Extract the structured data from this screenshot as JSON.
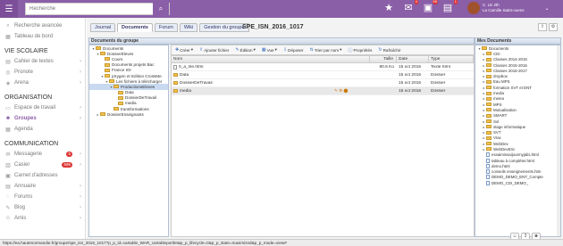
{
  "header": {
    "search_placeholder": "Recherche",
    "notifications": {
      "mail_count": "4",
      "messages_count": "99",
      "other_count": "1"
    },
    "user": {
      "name": "C. LE 2th",
      "role": "La Camille Saint-ouens"
    }
  },
  "sidebar": {
    "top_items": [
      {
        "label": "Recherche avancée"
      },
      {
        "label": "Tableau de bord"
      }
    ],
    "sections": [
      {
        "title": "VIE SCOLAIRE",
        "items": [
          {
            "label": "Cahier de textes"
          },
          {
            "label": "Pronote"
          },
          {
            "label": "Arena"
          }
        ]
      },
      {
        "title": "ORGANISATION",
        "items": [
          {
            "label": "Espace de travail"
          },
          {
            "label": "Groupes"
          },
          {
            "label": "Agenda"
          }
        ]
      },
      {
        "title": "COMMUNICATION",
        "items": [
          {
            "label": "Messagerie",
            "badge": "5"
          },
          {
            "label": "Casier",
            "badge": "596"
          },
          {
            "label": "Carnet d'adresses"
          },
          {
            "label": "Annuaire"
          },
          {
            "label": "Forums"
          },
          {
            "label": "Blog"
          },
          {
            "label": "Amis"
          }
        ]
      }
    ]
  },
  "main": {
    "tabs": [
      "Journal",
      "Documents",
      "Forum",
      "Wiki",
      "Gestion du groupe"
    ],
    "title": "SPE_ISN_2016_1017",
    "left_panel_title": "Documents du groupe",
    "right_panel_title": "Mes Documents",
    "tree": [
      {
        "label": "Documents",
        "depth": 0,
        "toggle": "▾"
      },
      {
        "label": "DossierEleves",
        "depth": 1,
        "toggle": "▾"
      },
      {
        "label": "Cours",
        "depth": 2,
        "toggle": ""
      },
      {
        "label": "Documents projets Bac",
        "depth": 2,
        "toggle": ""
      },
      {
        "label": "France IOI",
        "depth": 2,
        "toggle": ""
      },
      {
        "label": "pXygen et Edition CrossMe",
        "depth": 2,
        "toggle": "▾"
      },
      {
        "label": "Les fichiers à télécharger",
        "depth": 3,
        "toggle": "▾"
      },
      {
        "label": "ProductionsEleves",
        "depth": 4,
        "toggle": "▾",
        "selected": true
      },
      {
        "label": "Data",
        "depth": 5,
        "toggle": ""
      },
      {
        "label": "DossierDeTravail",
        "depth": 5,
        "toggle": ""
      },
      {
        "label": "media",
        "depth": 5,
        "toggle": ""
      },
      {
        "label": "transformations",
        "depth": 4,
        "toggle": ""
      },
      {
        "label": "DossierEnseignants",
        "depth": 1,
        "toggle": "▸"
      }
    ],
    "toolbar": [
      "Créer",
      "Ajouter fichier",
      "Édition",
      "Vue",
      "Déposer",
      "Trier par nom",
      "Propriétés",
      "Rafraîchir"
    ],
    "columns": [
      "Nom",
      "Taille",
      "Date",
      "Type"
    ],
    "rows": [
      {
        "name": "0_a_lire.html",
        "size": "80.5 Ko",
        "date": "15 oct 2016",
        "type": "Texte html",
        "kind": "doc"
      },
      {
        "name": "Data",
        "size": "",
        "date": "15 oct 2016",
        "type": "Dossier",
        "kind": "dir"
      },
      {
        "name": "DossierDeTravail",
        "size": "",
        "date": "15 oct 2016",
        "type": "Dossier",
        "kind": "dir"
      },
      {
        "name": "media",
        "size": "",
        "date": "15 oct 2016",
        "type": "Dossier",
        "kind": "dir",
        "selected": true
      }
    ],
    "mes_documents": [
      {
        "label": "Documents",
        "depth": 0,
        "toggle": "▾",
        "kind": "dir"
      },
      {
        "label": "CDI",
        "depth": 1,
        "toggle": "▸",
        "kind": "dir"
      },
      {
        "label": "Classes 2014-2015",
        "depth": 1,
        "toggle": "▸",
        "kind": "dir"
      },
      {
        "label": "Classes 2015-2016",
        "depth": 1,
        "toggle": "▸",
        "kind": "dir"
      },
      {
        "label": "Classes 2016-2017",
        "depth": 1,
        "toggle": "▸",
        "kind": "dir"
      },
      {
        "label": "dropbox",
        "depth": 1,
        "toggle": "▸",
        "kind": "dir"
      },
      {
        "label": "Eau MPS",
        "depth": 1,
        "toggle": "▸",
        "kind": "dir"
      },
      {
        "label": "formation SVT et ENT",
        "depth": 1,
        "toggle": "▸",
        "kind": "dir"
      },
      {
        "label": "media",
        "depth": 1,
        "toggle": "▸",
        "kind": "dir"
      },
      {
        "label": "meteo",
        "depth": 1,
        "toggle": "▸",
        "kind": "dir"
      },
      {
        "label": "MPS",
        "depth": 1,
        "toggle": "▸",
        "kind": "dir"
      },
      {
        "label": "Mutualisation",
        "depth": 1,
        "toggle": "▸",
        "kind": "dir"
      },
      {
        "label": "SMART",
        "depth": 1,
        "toggle": "▸",
        "kind": "dir"
      },
      {
        "label": "Sol",
        "depth": 1,
        "toggle": "▸",
        "kind": "dir"
      },
      {
        "label": "stage informatique",
        "depth": 1,
        "toggle": "▸",
        "kind": "dir"
      },
      {
        "label": "SVT",
        "depth": 1,
        "toggle": "▸",
        "kind": "dir"
      },
      {
        "label": "Vrac",
        "depth": 1,
        "toggle": "▸",
        "kind": "dir"
      },
      {
        "label": "WebDev",
        "depth": 1,
        "toggle": "▸",
        "kind": "dir"
      },
      {
        "label": "WebDevEric",
        "depth": 1,
        "toggle": "▸",
        "kind": "dir"
      },
      {
        "label": "essaimissaijourmyjalis.html",
        "depth": 1,
        "toggle": "",
        "kind": "doc"
      },
      {
        "label": "tableau à compléter.html",
        "depth": 1,
        "toggle": "",
        "kind": "doc"
      },
      {
        "label": "demo.html",
        "depth": 1,
        "toggle": "",
        "kind": "doc"
      },
      {
        "label": "conseils enseignements.htm",
        "depth": 1,
        "toggle": "",
        "kind": "doc"
      },
      {
        "label": "DEMO_DEMO_ENT_Compte",
        "depth": 1,
        "toggle": "",
        "kind": "doc"
      },
      {
        "label": "DEMO_CDI_DEMO_",
        "depth": 1,
        "toggle": "",
        "kind": "doc"
      }
    ]
  },
  "status_bar": {
    "url": "https://ea.hautenormandie.fr/groupe/spe_isn_2016_1017?p_p_id=cartable_WAR_cartableportlet&p_p_lifecycle=0&p_p_state=maximized&p_p_mode=view#",
    "counter": "3"
  }
}
